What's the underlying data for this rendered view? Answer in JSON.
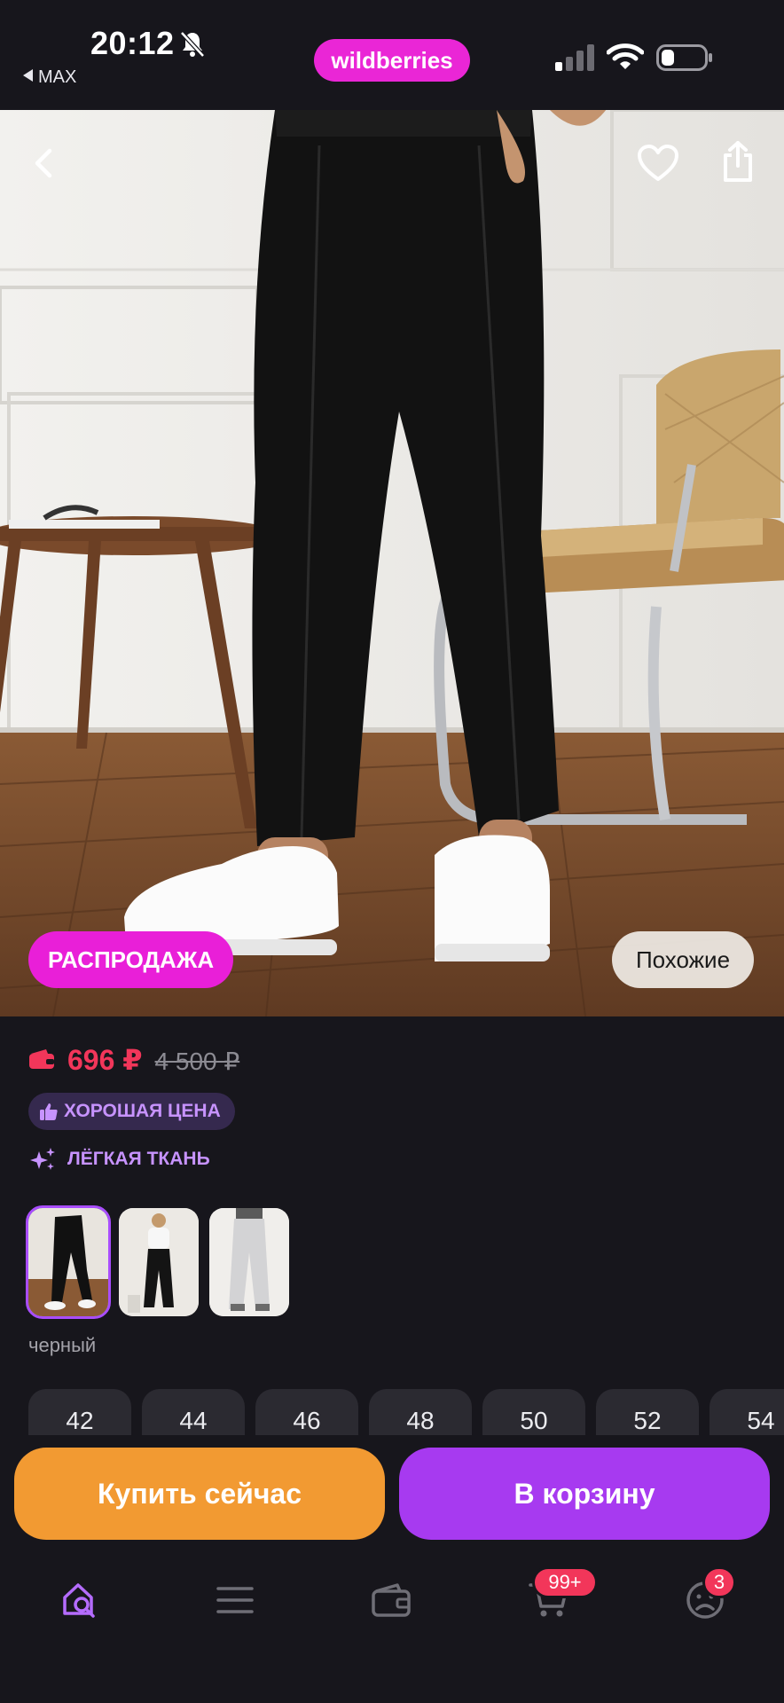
{
  "status": {
    "time": "20:12",
    "back_app": "MAX",
    "brand": "wildberries"
  },
  "hero": {
    "sale_badge": "РАСПРОДАЖА",
    "similar": "Похожие"
  },
  "product": {
    "price": "696 ₽",
    "old_price": "4 500 ₽",
    "good_price": "ХОРОШАЯ ЦЕНА",
    "feature": "ЛЁГКАЯ ТКАНЬ",
    "color_name": "черный",
    "sizes": [
      "42",
      "44",
      "46",
      "48",
      "50",
      "52",
      "54"
    ]
  },
  "actions": {
    "buy_now": "Купить сейчас",
    "to_cart": "В корзину"
  },
  "nav": {
    "cart_badge": "99+",
    "profile_badge": "3"
  },
  "colors": {
    "brand": "#ea26d6",
    "price": "#f2365a",
    "buy_now": "#f29a32",
    "to_cart": "#a73af0",
    "accent": "#c793ff"
  }
}
